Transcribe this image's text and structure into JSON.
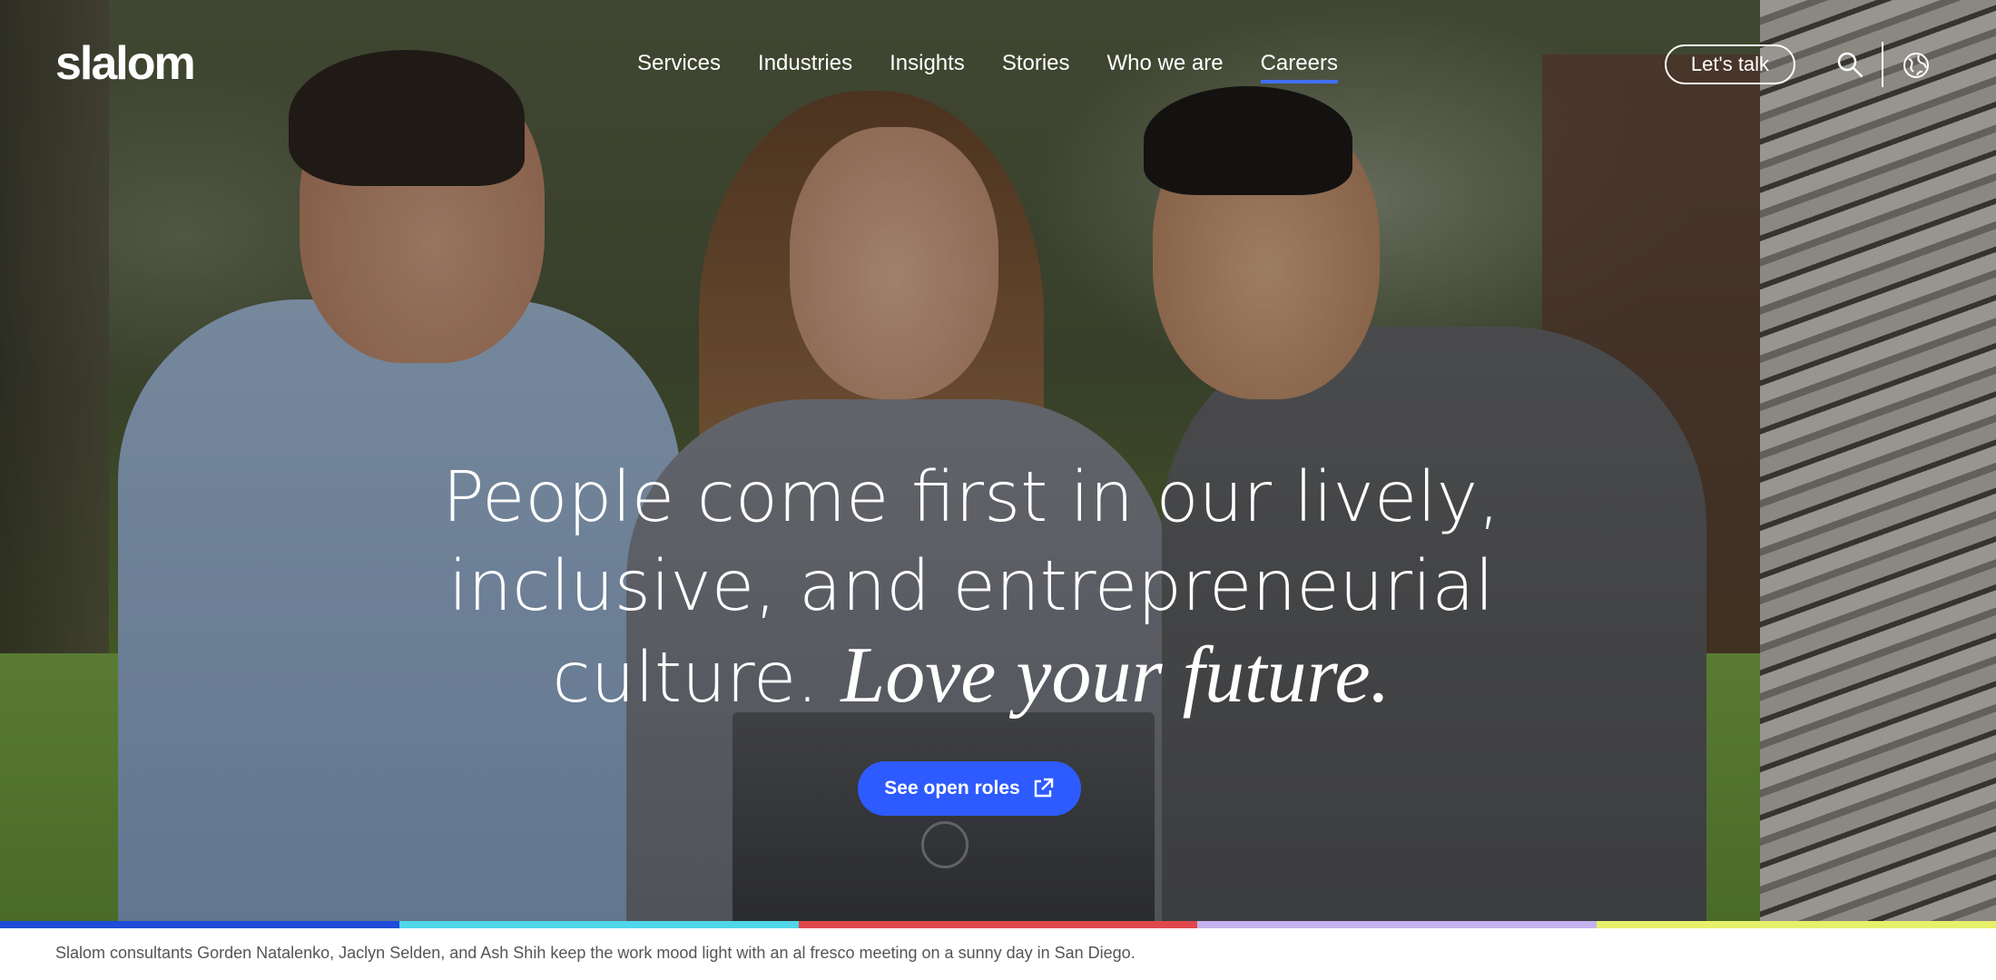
{
  "brand": {
    "logo_text": "slalom"
  },
  "nav": {
    "items": [
      {
        "label": "Services"
      },
      {
        "label": "Industries"
      },
      {
        "label": "Insights"
      },
      {
        "label": "Stories"
      },
      {
        "label": "Who we are"
      },
      {
        "label": "Careers",
        "active": true
      }
    ]
  },
  "header": {
    "cta_label": "Let's talk",
    "search_icon": "search-icon",
    "globe_icon": "globe-icon"
  },
  "hero": {
    "headline_plain": "People come first in our lively, inclusive, and entrepreneurial culture.",
    "headline_italic": "Love your future.",
    "cta_label": "See open roles",
    "cta_icon": "external-link-icon"
  },
  "band_colors": [
    "#1e4bd8",
    "#4fd6e8",
    "#e0474c",
    "#c3b2ee",
    "#e6f06a"
  ],
  "caption": "Slalom consultants Gorden Natalenko, Jaclyn Selden, and Ash Shih keep the work mood light with an al fresco meeting on a sunny day in San Diego."
}
